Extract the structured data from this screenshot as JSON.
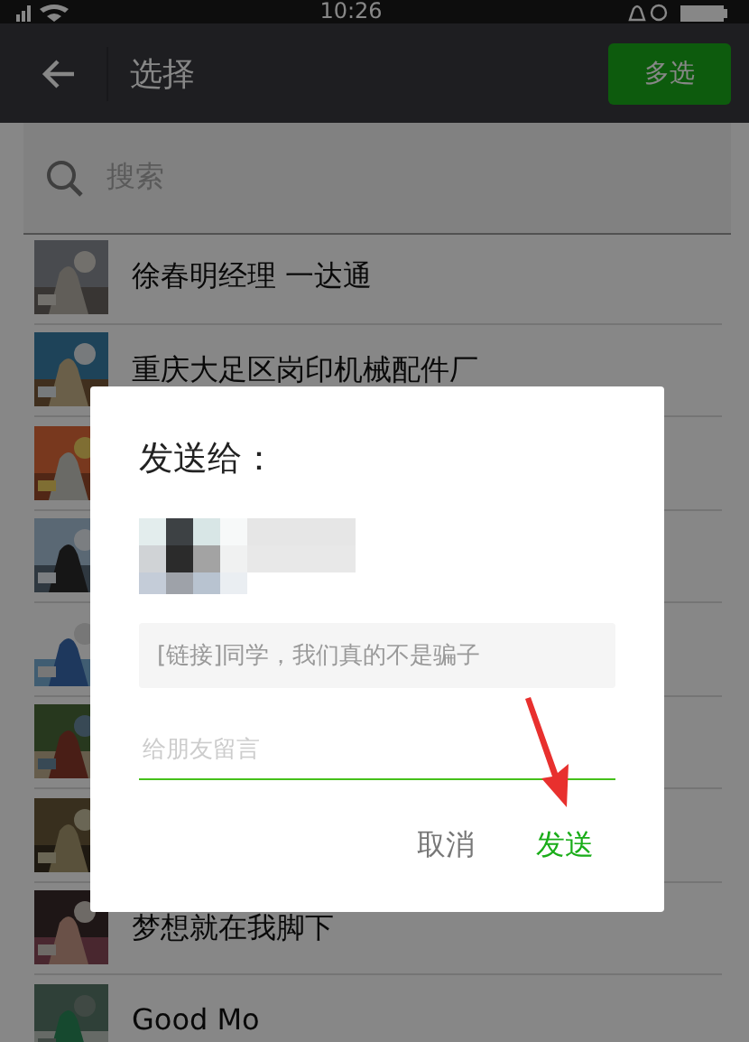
{
  "status_bar": {
    "time": "10:26"
  },
  "header": {
    "title": "选择",
    "action_button": "多选"
  },
  "search": {
    "placeholder": "搜索"
  },
  "contacts": [
    {
      "name": "徐春明经理 一达通",
      "avatar": {
        "kind": "picture"
      }
    },
    {
      "name": "重庆大足区岗印机械配件厂",
      "avatar": {
        "kind": "picture"
      }
    },
    {
      "avatar": {
        "kind": "picture"
      }
    },
    {
      "avatar": {
        "kind": "picture"
      }
    },
    {
      "avatar": {
        "kind": "picture"
      }
    },
    {
      "avatar": {
        "kind": "picture"
      }
    },
    {
      "avatar": {
        "kind": "picture"
      }
    },
    {
      "name": "梦想就在我脚下",
      "avatar": {
        "kind": "picture"
      }
    },
    {
      "name": "Good Mo",
      "avatar": {
        "kind": "picture"
      }
    }
  ],
  "dialog": {
    "title": "发送给：",
    "recipient": {
      "kind": "picture"
    },
    "link_preview": "[链接]同学，我们真的不是骗子",
    "message_field": {
      "placeholder": "给朋友留言"
    },
    "buttons": [
      {
        "label": "取消",
        "kind": "cancel"
      },
      {
        "label": "发送",
        "kind": "confirm"
      }
    ]
  },
  "annotation": {
    "kind": "arrow"
  }
}
